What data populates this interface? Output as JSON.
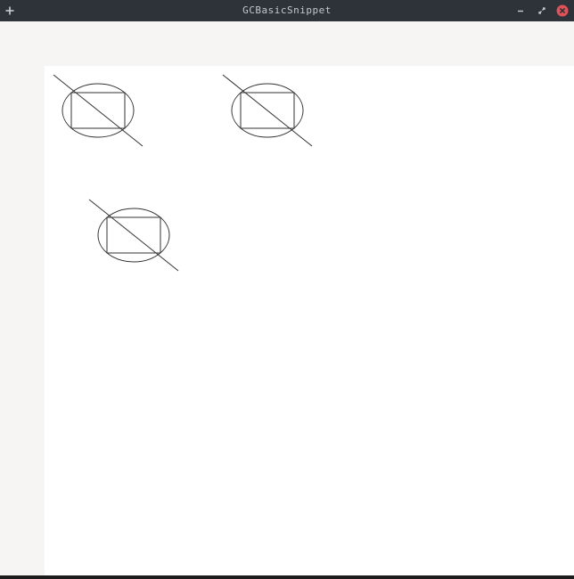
{
  "window": {
    "title": "GCBasicSnippet",
    "titlebar_color": "#2d3339",
    "close_button_color": "#e0525a"
  },
  "titlebar_buttons": {
    "add_icon": "plus-icon",
    "minimize_icon": "minimize-icon",
    "maximize_icon": "maximize-icon",
    "close_icon": "close-icon"
  },
  "canvas": {
    "background": "#ffffff",
    "stroke_color": "#333333",
    "shape_group_count": 3
  }
}
